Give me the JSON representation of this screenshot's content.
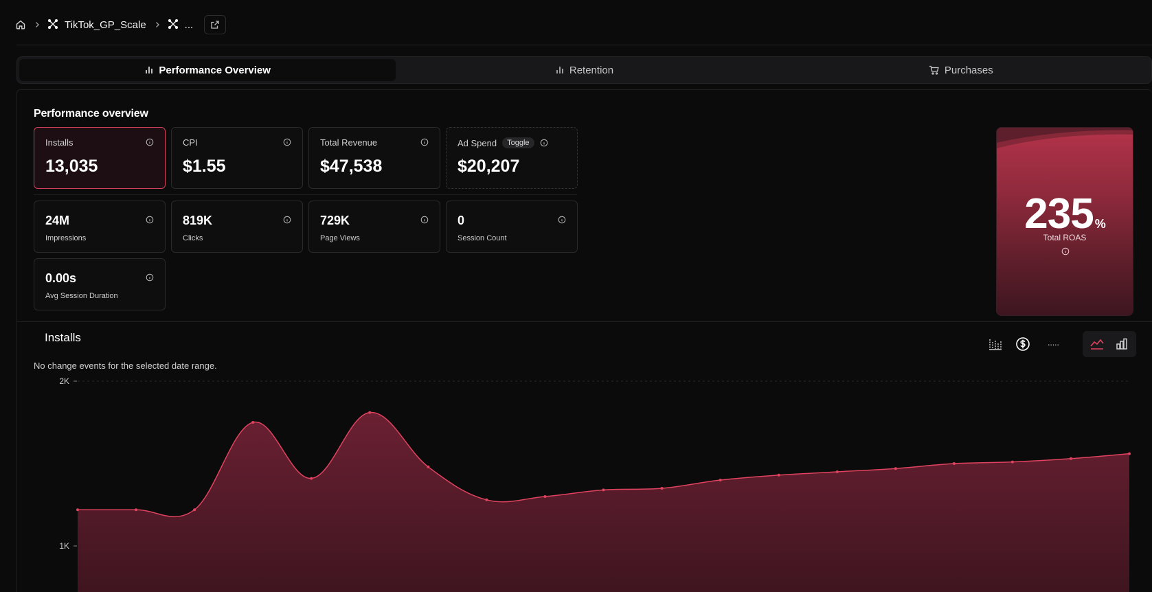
{
  "breadcrumb": {
    "items": [
      {
        "label": "TikTok_GP_Scale"
      },
      {
        "label": "..."
      }
    ]
  },
  "tabs": [
    {
      "label": "Performance Overview",
      "active": true
    },
    {
      "label": "Retention",
      "active": false
    },
    {
      "label": "Purchases",
      "active": false
    }
  ],
  "overview": {
    "title": "Performance overview",
    "primary_cards": [
      {
        "label": "Installs",
        "value": "13,035"
      },
      {
        "label": "CPI",
        "value": "$1.55"
      },
      {
        "label": "Total Revenue",
        "value": "$47,538"
      },
      {
        "label": "Ad Spend",
        "value": "$20,207",
        "badge": "Toggle"
      }
    ],
    "secondary_cards": [
      {
        "value": "24M",
        "label": "Impressions"
      },
      {
        "value": "819K",
        "label": "Clicks"
      },
      {
        "value": "729K",
        "label": "Page Views"
      },
      {
        "value": "0",
        "label": "Session Count"
      },
      {
        "value": "0.00s",
        "label": "Avg Session Duration"
      }
    ],
    "roas": {
      "value": "235",
      "unit": "%",
      "label": "Total ROAS"
    }
  },
  "chart_section": {
    "title": "Installs",
    "note": "No change events for the selected date range.",
    "tools": {
      "dots_label": "·····"
    }
  },
  "colors": {
    "accent": "#e0435f",
    "area_fill": "#5a1d2b",
    "background": "#0b0b0c"
  },
  "chart_data": {
    "type": "area",
    "y_ticks": [
      "2K",
      "1K"
    ],
    "ylim_visible": [
      1000,
      2000
    ],
    "values": [
      1220,
      1220,
      1220,
      1750,
      1410,
      1810,
      1480,
      1280,
      1300,
      1340,
      1350,
      1400,
      1430,
      1450,
      1470,
      1500,
      1510,
      1530,
      1560
    ],
    "points_sampled_indices_note": ""
  }
}
